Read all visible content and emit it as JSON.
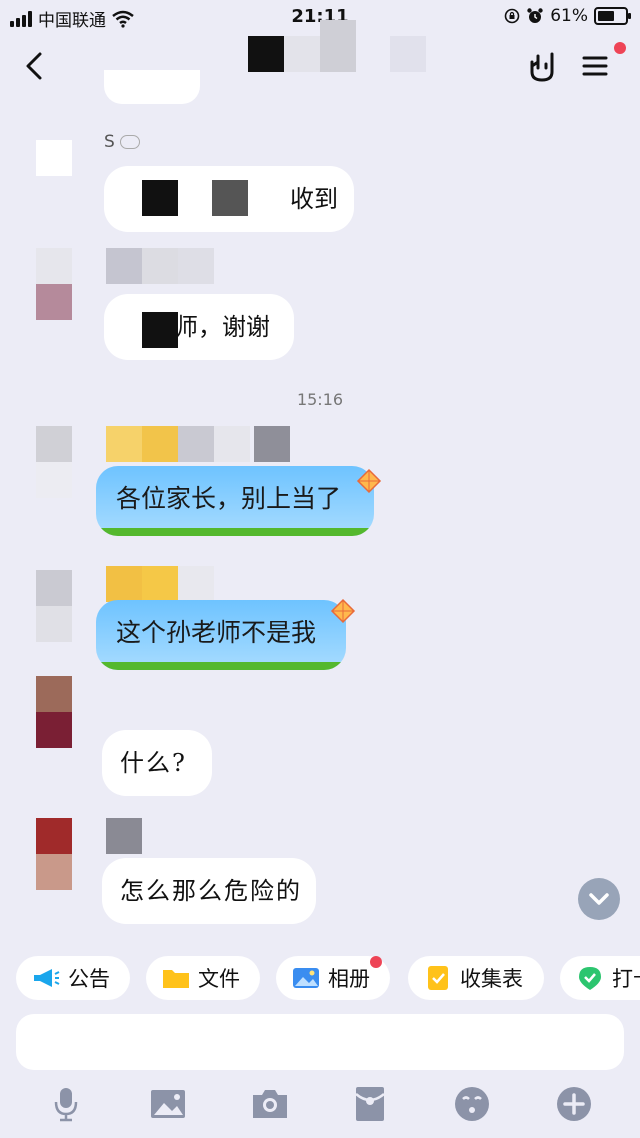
{
  "status_bar": {
    "carrier": "中国联通",
    "time": "21:11",
    "battery": "61%",
    "battery_level": 0.61
  },
  "nav": {
    "back_icon": "chevron-left-icon",
    "gesture_icon": "rock-hand-icon",
    "menu_icon": "hamburger-menu-icon",
    "menu_badge_color": "#ee4456"
  },
  "messages": [
    {
      "sender_initial": "S",
      "text": "收到",
      "type": "text"
    },
    {
      "text": "老师，谢谢",
      "type": "text"
    },
    {
      "type": "time",
      "text": "15:16"
    },
    {
      "text": "各位家长，别上当了",
      "type": "special"
    },
    {
      "text": "这个孙老师不是我",
      "type": "special"
    },
    {
      "text": "什么?",
      "type": "text"
    },
    {
      "text": "怎么那么危险的",
      "type": "text"
    }
  ],
  "quick_actions": [
    {
      "label": "公告",
      "icon": "megaphone-icon"
    },
    {
      "label": "文件",
      "icon": "folder-icon"
    },
    {
      "label": "相册",
      "icon": "photo-album-icon",
      "badge": true
    },
    {
      "label": "收集表",
      "icon": "form-icon"
    },
    {
      "label": "打卡",
      "icon": "checkin-icon"
    }
  ],
  "composer": {
    "placeholder": ""
  },
  "toolbar": [
    "microphone-icon",
    "image-icon",
    "camera-icon",
    "red-packet-icon",
    "emoji-icon",
    "plus-icon"
  ],
  "colors": {
    "bubble_special": "#6ec3ff",
    "grass": "#54b82e",
    "background": "#ececf6"
  }
}
